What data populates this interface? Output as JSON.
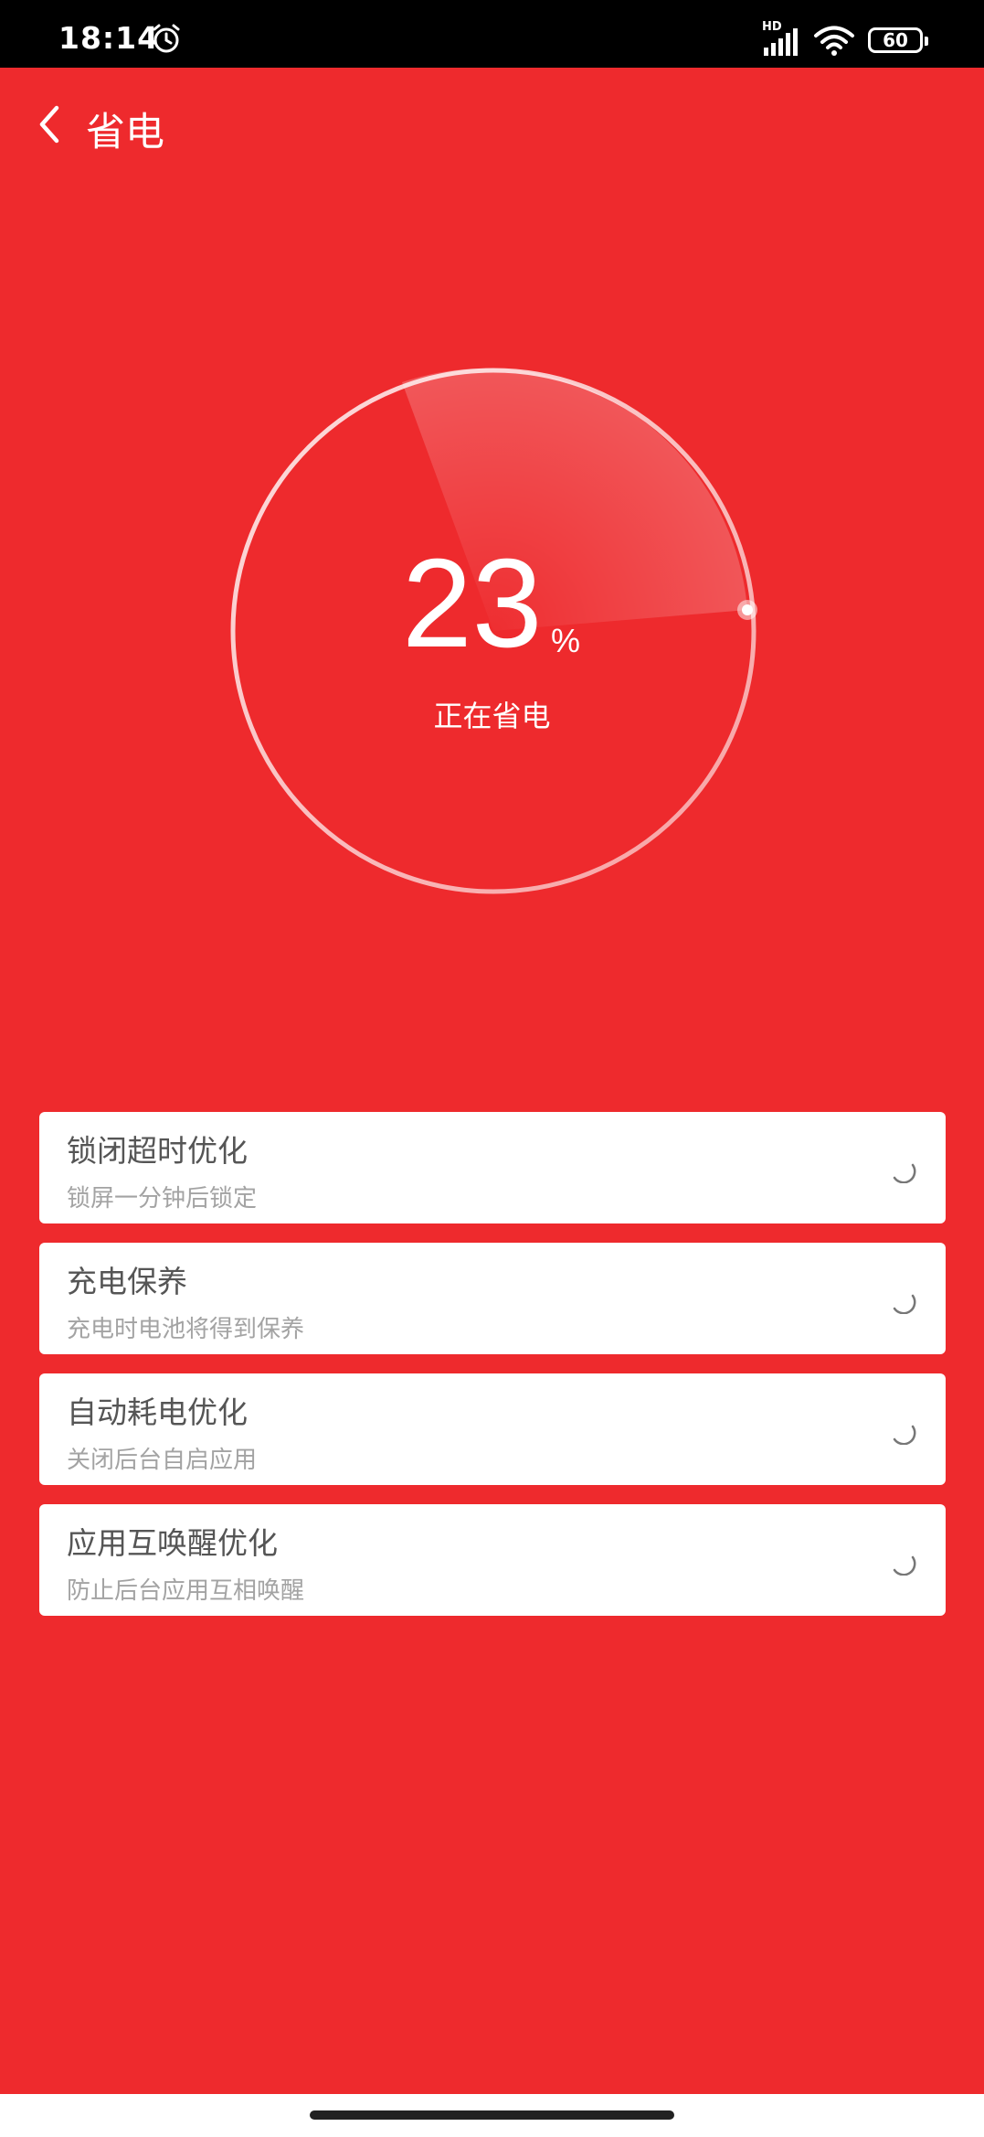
{
  "status_bar": {
    "time": "18:14",
    "network_label": "HD",
    "battery": "60",
    "icons": [
      "alarm-clock-icon",
      "signal-icon",
      "wifi-icon",
      "battery-icon"
    ]
  },
  "header": {
    "title": "省电",
    "back_icon": "chevron-left-icon"
  },
  "dial": {
    "value": "23",
    "unit": "%",
    "status": "正在省电",
    "progress_fraction": 0.23
  },
  "items": [
    {
      "title": "锁闭超时优化",
      "subtitle": "锁屏一分钟后锁定"
    },
    {
      "title": "充电保养",
      "subtitle": "充电时电池将得到保养"
    },
    {
      "title": "自动耗电优化",
      "subtitle": "关闭后台自启应用"
    },
    {
      "title": "应用互唤醒优化",
      "subtitle": "防止后台应用互相唤醒"
    }
  ],
  "colors": {
    "background": "#ee2a2d",
    "card": "#ffffff",
    "title_text": "#555555",
    "subtitle_text": "#a3a3a3"
  }
}
